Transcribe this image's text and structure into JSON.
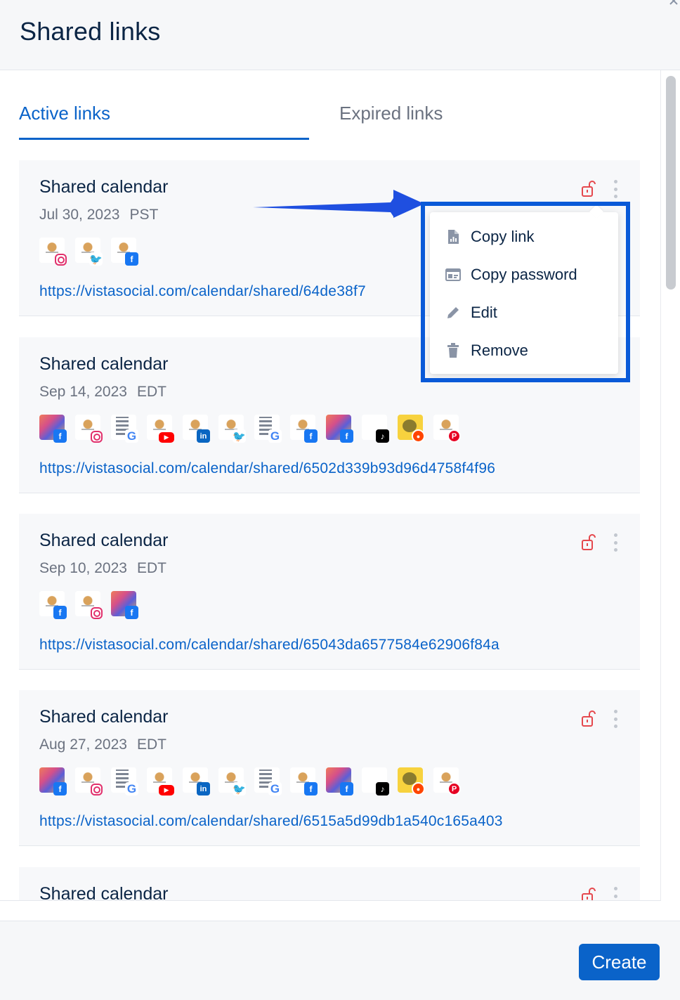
{
  "dialog": {
    "title": "Shared links",
    "close_icon": "close-icon"
  },
  "tabs": [
    {
      "label": "Active links",
      "active": true
    },
    {
      "label": "Expired links",
      "active": false
    }
  ],
  "colors": {
    "accent": "#0a63c9",
    "lock": "#e5484d",
    "highlight": "#0a5ad8"
  },
  "cards": [
    {
      "title": "Shared calendar",
      "date": "Jul 30, 2023",
      "tz": "PST",
      "url": "https://vistasocial.com/calendar/shared/64de38f7",
      "profiles": [
        {
          "avatar": "logo",
          "network": "instagram-icon"
        },
        {
          "avatar": "logo",
          "network": "twitter-icon"
        },
        {
          "avatar": "logo",
          "network": "facebook-icon"
        }
      ]
    },
    {
      "title": "Shared calendar",
      "date": "Sep 14, 2023",
      "tz": "EDT",
      "url": "https://vistasocial.com/calendar/shared/6502d339b93d96d4758f4f96",
      "profiles": [
        {
          "avatar": "colorful",
          "network": "facebook-icon"
        },
        {
          "avatar": "logo",
          "network": "instagram-icon"
        },
        {
          "avatar": "building",
          "network": "google-icon"
        },
        {
          "avatar": "logo",
          "network": "youtube-icon"
        },
        {
          "avatar": "logo",
          "network": "linkedin-icon"
        },
        {
          "avatar": "logo",
          "network": "twitter-icon"
        },
        {
          "avatar": "building",
          "network": "google-icon"
        },
        {
          "avatar": "logo",
          "network": "facebook-icon"
        },
        {
          "avatar": "colorful",
          "network": "facebook-icon"
        },
        {
          "avatar": "tiktok-av",
          "network": "tiktok-icon"
        },
        {
          "avatar": "reddit",
          "network": "reddit-icon"
        },
        {
          "avatar": "logo",
          "network": "pinterest-icon"
        }
      ]
    },
    {
      "title": "Shared calendar",
      "date": "Sep 10, 2023",
      "tz": "EDT",
      "url": "https://vistasocial.com/calendar/shared/65043da6577584e62906f84a",
      "profiles": [
        {
          "avatar": "logo",
          "network": "facebook-icon"
        },
        {
          "avatar": "logo",
          "network": "instagram-icon"
        },
        {
          "avatar": "colorful",
          "network": "facebook-icon"
        }
      ]
    },
    {
      "title": "Shared calendar",
      "date": "Aug 27, 2023",
      "tz": "EDT",
      "url": "https://vistasocial.com/calendar/shared/6515a5d99db1a540c165a403",
      "profiles": [
        {
          "avatar": "colorful",
          "network": "facebook-icon"
        },
        {
          "avatar": "logo",
          "network": "instagram-icon"
        },
        {
          "avatar": "building",
          "network": "google-icon"
        },
        {
          "avatar": "logo",
          "network": "youtube-icon"
        },
        {
          "avatar": "logo",
          "network": "linkedin-icon"
        },
        {
          "avatar": "logo",
          "network": "twitter-icon"
        },
        {
          "avatar": "building",
          "network": "google-icon"
        },
        {
          "avatar": "logo",
          "network": "facebook-icon"
        },
        {
          "avatar": "colorful",
          "network": "facebook-icon"
        },
        {
          "avatar": "tiktok-av",
          "network": "tiktok-icon"
        },
        {
          "avatar": "reddit",
          "network": "reddit-icon"
        },
        {
          "avatar": "logo",
          "network": "pinterest-icon"
        }
      ]
    },
    {
      "title": "Shared calendar"
    }
  ],
  "context_menu": {
    "items": [
      {
        "label": "Copy link",
        "icon": "document-chart-icon"
      },
      {
        "label": "Copy password",
        "icon": "password-card-icon"
      },
      {
        "label": "Edit",
        "icon": "pencil-icon"
      },
      {
        "label": "Remove",
        "icon": "trash-icon"
      }
    ]
  },
  "footer": {
    "create_label": "Create"
  }
}
